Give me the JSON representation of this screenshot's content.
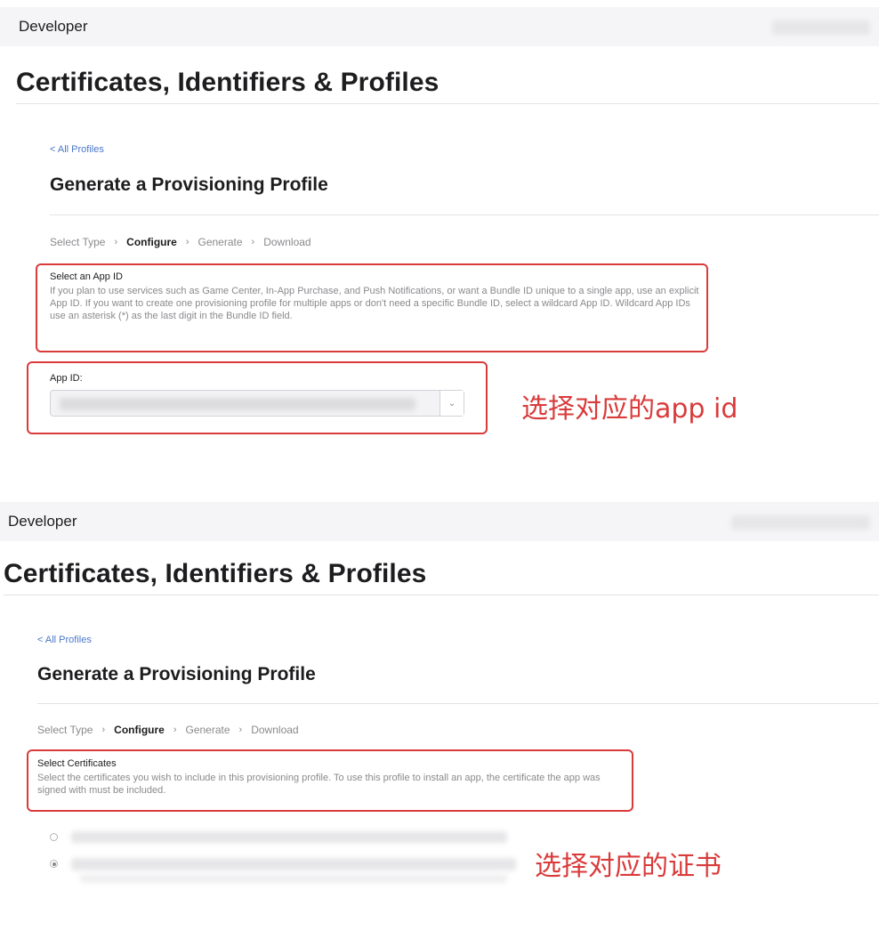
{
  "colors": {
    "annotation": "#d93b3b",
    "link": "#4a77c9",
    "topbar": "#f5f5f7"
  },
  "panel1": {
    "brand": "Developer",
    "title": "Certificates, Identifiers & Profiles",
    "back_link": "< All Profiles",
    "subtitle": "Generate a Provisioning Profile",
    "steps": [
      "Select Type",
      "Configure",
      "Generate",
      "Download"
    ],
    "active_step": "Configure",
    "section_heading": "Select an App ID",
    "section_description": "If you plan to use services such as Game Center, In-App Purchase, and Push Notifications, or want a Bundle ID unique to a single app, use an explicit App ID. If you want to create one provisioning profile for multiple apps or don't need a specific Bundle ID, select a wildcard App ID. Wildcard App IDs use an asterisk (*) as the last digit in the Bundle ID field.",
    "field_label": "App ID:",
    "annotation": "选择对应的app id"
  },
  "panel2": {
    "brand": "Developer",
    "title": "Certificates, Identifiers & Profiles",
    "back_link": "< All Profiles",
    "subtitle": "Generate a Provisioning Profile",
    "steps": [
      "Select Type",
      "Configure",
      "Generate",
      "Download"
    ],
    "active_step": "Configure",
    "section_heading": "Select Certificates",
    "section_description": "Select the certificates you wish to include in this provisioning profile. To use this profile to install an app, the certificate the app was signed with must be included.",
    "annotation": "选择对应的证书"
  },
  "icons": {
    "brand": "apple-logo-icon",
    "step_separator": "chevron-right-icon",
    "dropdown": "chevron-down-icon"
  }
}
